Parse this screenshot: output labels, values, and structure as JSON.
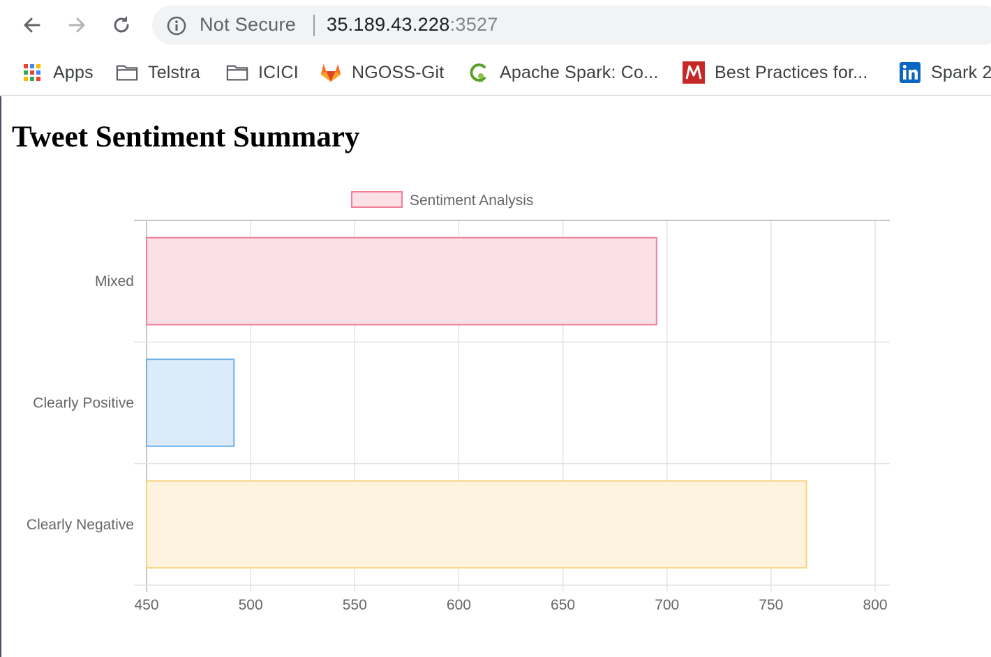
{
  "browser": {
    "nav": {
      "back_icon": "arrow-left-icon",
      "forward_icon": "arrow-right-icon",
      "reload_icon": "reload-icon"
    },
    "address_bar": {
      "security_icon": "info-circle-icon",
      "security_label": "Not Secure",
      "host": "35.189.43.228",
      "port": ":3527"
    },
    "bookmarks": [
      {
        "label": "Apps",
        "icon": "apps-grid-icon"
      },
      {
        "label": "Telstra",
        "icon": "folder-icon"
      },
      {
        "label": "ICICI",
        "icon": "folder-icon"
      },
      {
        "label": "NGOSS-Git",
        "icon": "gitlab-fox-icon"
      },
      {
        "label": "Apache Spark: Co...",
        "icon": "spark-site-icon"
      },
      {
        "label": "Best Practices for...",
        "icon": "m-logo-icon"
      },
      {
        "label": "Spark 2",
        "icon": "linkedin-icon"
      }
    ]
  },
  "page": {
    "title": "Tweet Sentiment Summary"
  },
  "chart_data": {
    "type": "bar",
    "orientation": "horizontal",
    "categories": [
      "Mixed",
      "Clearly Positive",
      "Clearly Negative"
    ],
    "series": [
      {
        "name": "Sentiment Analysis",
        "values": [
          695,
          492,
          767
        ]
      }
    ],
    "bar_fills": [
      "#fbe0e6",
      "#dcebf9",
      "#fdf3de"
    ],
    "bar_strokes": [
      "#f07f98",
      "#6fb0e8",
      "#f7d27a"
    ],
    "legend_fill": "#fbe0e6",
    "legend_stroke": "#f07f98",
    "xlim": [
      450,
      800
    ],
    "x_ticks": [
      "450",
      "500",
      "550",
      "600",
      "650",
      "700",
      "750",
      "800"
    ],
    "legend_position": "top",
    "grid": true
  }
}
